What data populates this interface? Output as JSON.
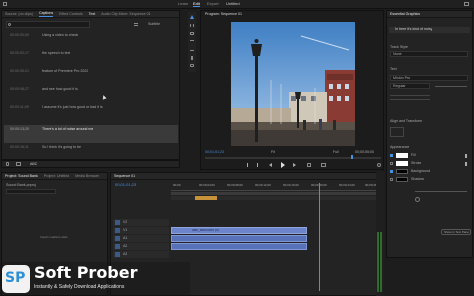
{
  "menubar": {
    "title": "Untitled",
    "tabs": [
      "Learn",
      "Edit",
      "Export"
    ],
    "right_icon": "window-icon"
  },
  "left_panel": {
    "tabs": [
      "Source: (no clips)",
      "Captions",
      "Effect Controls",
      "Text",
      "Audio Clip Mixer: Sequence 01"
    ],
    "toolbar_label": "Subtitle",
    "search_placeholder": "",
    "captions": [
      {
        "time": "00:00:00;00",
        "text": "Using a video to check"
      },
      {
        "time": "00:00:02;17",
        "text": "the speech to text"
      },
      {
        "time": "00:00:05;21",
        "text": "feature of Premiere Pro 2022"
      },
      {
        "time": "00:00:08;27",
        "text": "and see how good it is"
      },
      {
        "time": "00:00:11;09",
        "text": "I assume it's just how good or bad it is"
      },
      {
        "time": "00:00:13;20",
        "text": "There's a lot of noise around me"
      },
      {
        "time": "00:00:16;11",
        "text": "So I think it's going to be"
      }
    ],
    "footer_label": "ABC"
  },
  "program_monitor": {
    "tab": "Program: Sequence 01",
    "timecode_left": "00;01;01;23",
    "fit_label": "Fit",
    "quality_label": "Full",
    "timecode_right": "00;00;55;00"
  },
  "essential_graphics": {
    "title": "Essential Graphics",
    "layer_label": "In here it's kind of noisy",
    "track_style_label": "Track Style",
    "track_style_value": "None",
    "text_section": "Text",
    "font_value": "Minion Pro",
    "font_style": "Regular",
    "align_section": "Align and Transform",
    "appearance_section": "Appearance",
    "fill_label": "Fill",
    "stroke_label": "Stroke",
    "background_label": "Background",
    "shadow_label": "Shadow",
    "show_in_text_panel": "Show in Text Panel"
  },
  "project_panel": {
    "tabs": [
      "Project: Sound Bank",
      "Project: Untitled",
      "Media Browser"
    ],
    "file_label": "Sound Bank.prproj",
    "import_label": "Import media to start"
  },
  "timeline": {
    "tab": "Sequence 01",
    "timecode": "00;01;01;23",
    "ruler": [
      "00;00",
      "00;00;04;00",
      "00;00;08;00",
      "00;00;12;00",
      "00;00;16;00",
      "00;00;20;00",
      "00;00;24;00",
      "00;00;28;00"
    ],
    "tracks": [
      "V2",
      "V1",
      "A1",
      "A2",
      "A3"
    ],
    "clip_label": "ABC_0002.MOV [V]",
    "subtitle_label": "Subtitle"
  },
  "watermark": {
    "brand": "Soft Prober",
    "tagline": "Instantly & Safely Download Applications",
    "logo_text": "SP"
  },
  "colors": {
    "accent_blue": "#4a90e2",
    "clip_blue": "#6c84c9",
    "clip_orange": "#c8923a",
    "brand_blue": "#2d8fd5"
  }
}
